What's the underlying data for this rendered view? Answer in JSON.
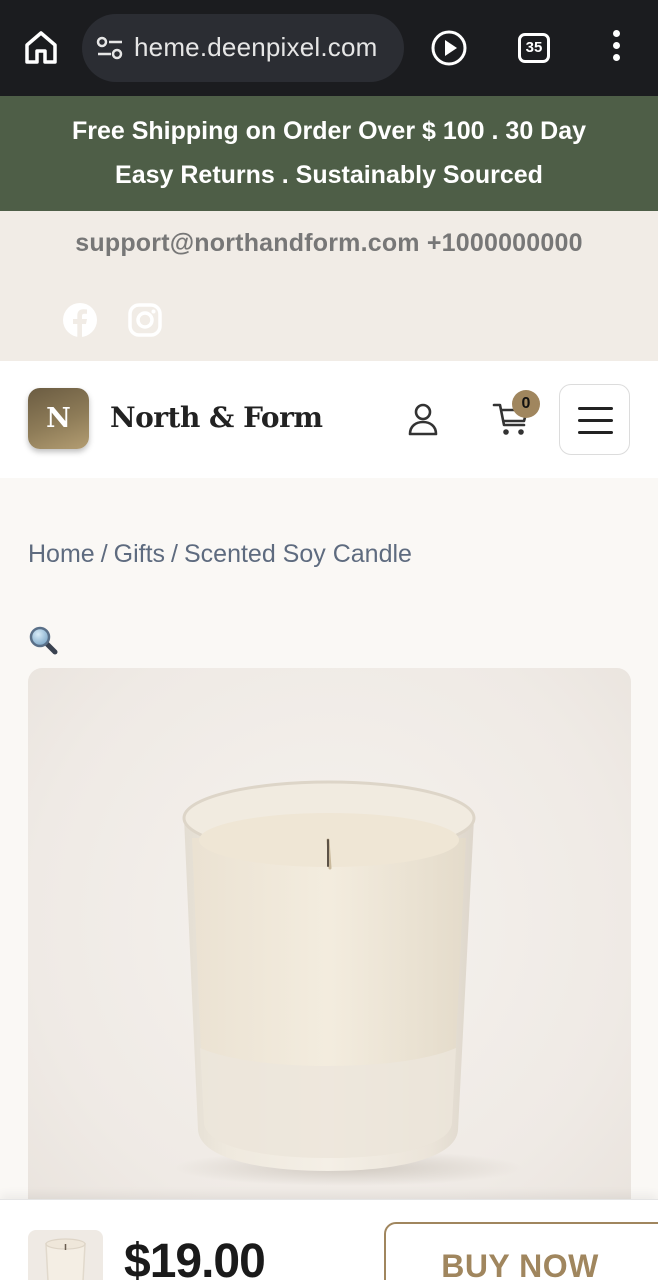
{
  "browser": {
    "url": "heme.deenpixel.com",
    "tab_count": "35"
  },
  "announcement": {
    "line1": "Free Shipping on Order Over $ 100 . 30 Day",
    "line2": "Easy Returns . Sustainably Sourced"
  },
  "contact": {
    "text": "support@northandform.com +1000000000"
  },
  "header": {
    "logo_letter": "N",
    "brand_name": "North & Form",
    "cart_count": "0"
  },
  "breadcrumb": {
    "items": [
      "Home",
      "Gifts",
      "Scented Soy Candle"
    ],
    "separator": "/"
  },
  "buy_bar": {
    "price": "$19.00",
    "buy_label": "BUY NOW"
  },
  "colors": {
    "announcement_bg": "#4e5e47",
    "accent": "#a0865e",
    "breadcrumb_text": "#5e6b7f"
  },
  "icons": [
    "home-icon",
    "tune-icon",
    "play-icon",
    "tabs-icon",
    "more-icon",
    "facebook-icon",
    "instagram-icon",
    "user-icon",
    "cart-icon",
    "menu-icon",
    "zoom-icon"
  ]
}
